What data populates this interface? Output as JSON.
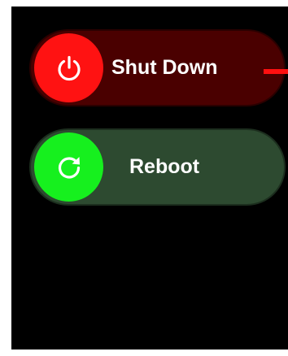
{
  "shutdown": {
    "label": "Shut Down",
    "icon": "power-icon",
    "knob_color": "#ff1212",
    "track_color": "#4a0000"
  },
  "reboot": {
    "label": "Reboot",
    "icon": "refresh-icon",
    "knob_color": "#16f01e",
    "track_color": "#2d4a30"
  },
  "colors": {
    "background": "#000000",
    "accent_marker": "#ff1010"
  }
}
